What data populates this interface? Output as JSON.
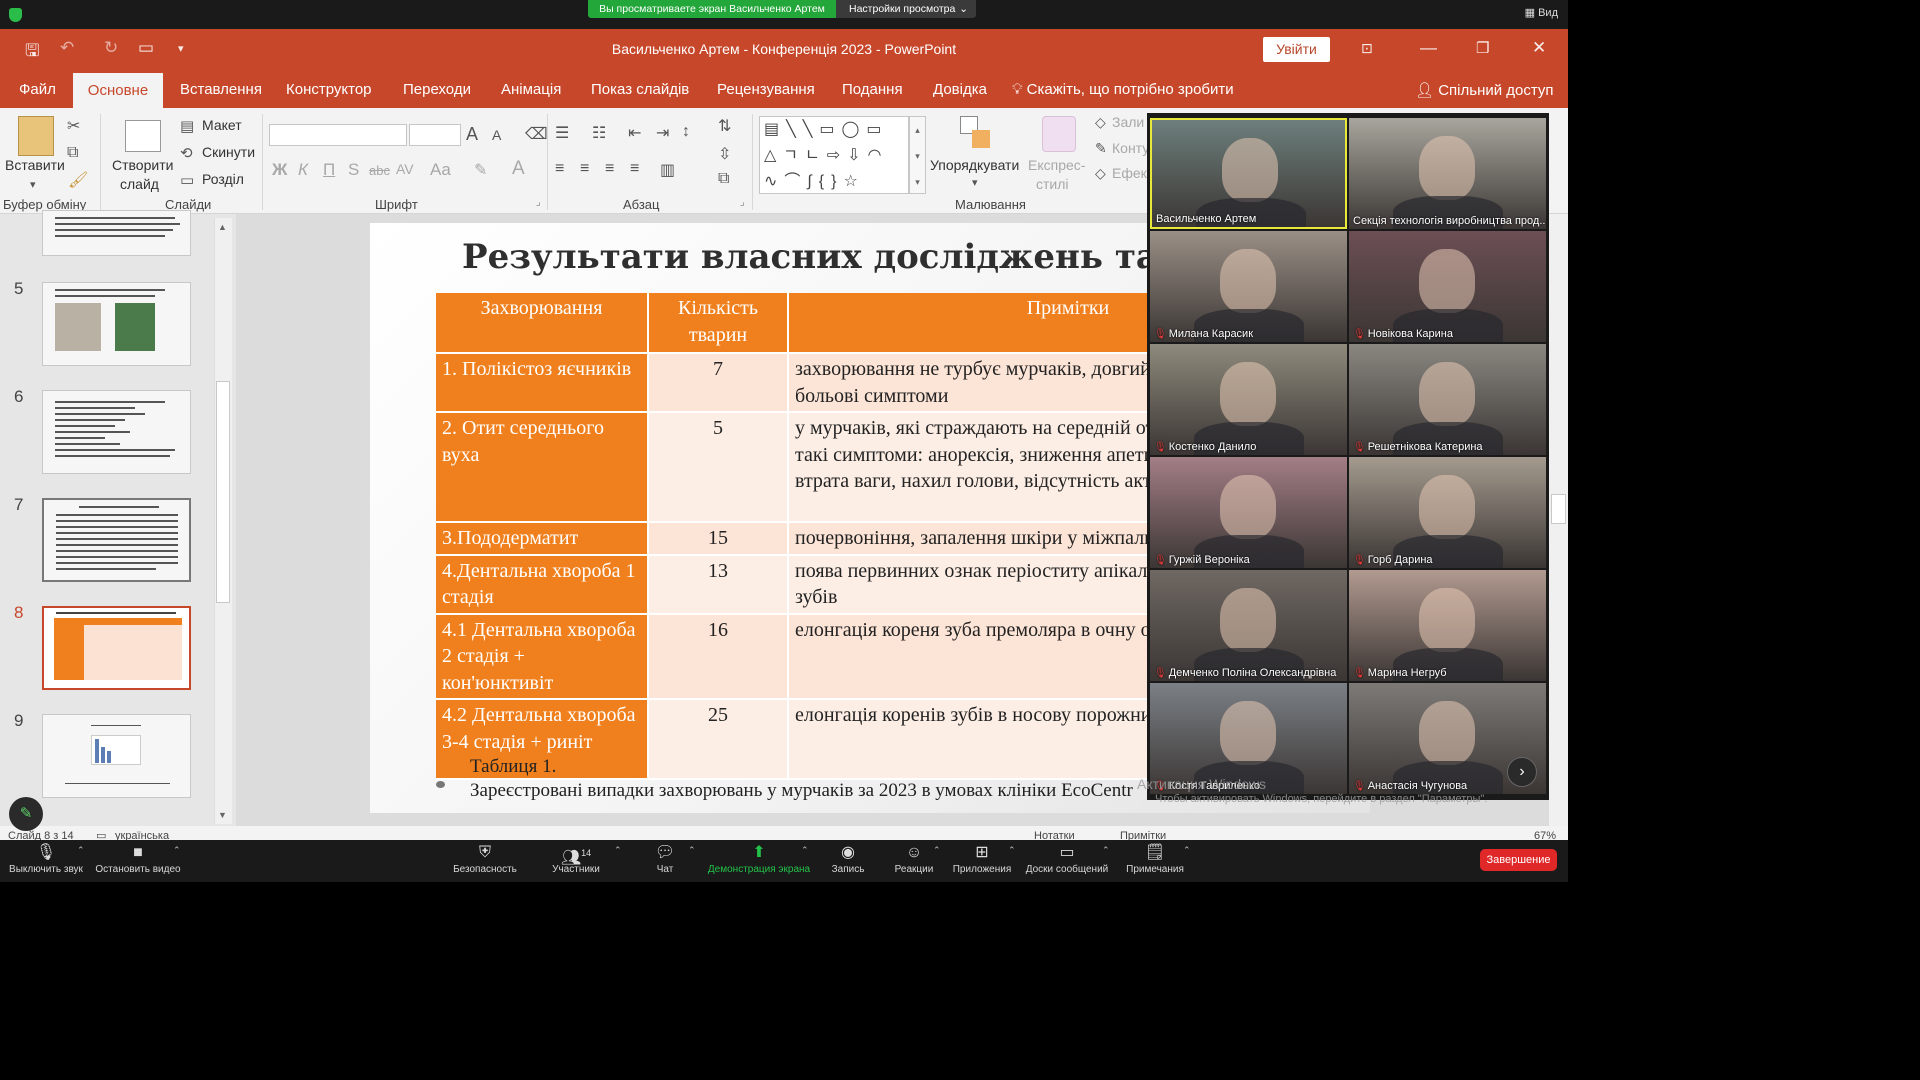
{
  "zoom_top": {
    "banner": "Вы просматриваете экран Васильченко Артем",
    "view_options": "Настройки просмотра",
    "view_label": "Вид"
  },
  "titlebar": {
    "title": "Васильченко Артем - Конференція 2023  -  PowerPoint",
    "signin": "Увійти"
  },
  "tabs": [
    "Файл",
    "Основне",
    "Вставлення",
    "Конструктор",
    "Переходи",
    "Анімація",
    "Показ слайдів",
    "Рецензування",
    "Подання",
    "Довідка"
  ],
  "tell_me": "Скажіть, що потрібно зробити",
  "share": "Спільний доступ",
  "ribbon": {
    "paste": "Вставити",
    "clipboard": "Буфер обміну",
    "new_slide_1": "Створити",
    "new_slide_2": "слайд",
    "layout": "Макет",
    "reset": "Скинути",
    "section": "Розділ",
    "slides": "Слайди",
    "font": "Шрифт",
    "bold": "Ж",
    "italic": "К",
    "underline": "П",
    "shadow": "S",
    "strike": "abc",
    "spacing": "AV",
    "case": "Aa",
    "paragraph": "Абзац",
    "arrange": "Упорядкувати",
    "quick_styles_1": "Експрес-",
    "quick_styles_2": "стилі",
    "fill": "Зали",
    "outline": "Конту",
    "effects": "Ефек",
    "drawing": "Малювання"
  },
  "thumbnails": [
    {
      "num": "5"
    },
    {
      "num": "6"
    },
    {
      "num": "7"
    },
    {
      "num": "8"
    },
    {
      "num": "9"
    }
  ],
  "slide": {
    "title": "Результати власних досліджень та їх аналіз",
    "headers": [
      "Захворювання",
      "Кількість тварин",
      "Примітки"
    ],
    "rows": [
      {
        "disease": "1. Полікістоз яєчників",
        "count": "7",
        "note": "захворювання не турбує мурчаків, довгий час не виявляючи больові симптоми"
      },
      {
        "disease": "2. Отит середнього вуха",
        "count": "5",
        "note": "у мурчаків, які страждають на середній отит, спостерігаються такі симптоми: анорексія, зниження апетиту, різка і поступова втрата ваги, нахил голови, відсутність активності."
      },
      {
        "disease": "3.Пододерматит",
        "count": "15",
        "note": "почервоніння, запалення шкіри у міжпальцевих ділянках"
      },
      {
        "disease": "4.Дентальна хвороба 1 стадія",
        "count": "13",
        "note": "поява первинних ознак періоститу апікальних коренів щічних зубів"
      },
      {
        "disease": "4.1 Дентальна хвороба 2 стадія + кон'юнктивіт",
        "count": "16",
        "note": "елонгація кореня зуба премоляра в очну орбіту"
      },
      {
        "disease": "4.2 Дентальна хвороба 3-4 стадія + риніт",
        "count": "25",
        "note": "елонгація коренів зубів в носову порожнину"
      }
    ],
    "caption_1": "Таблиця 1.",
    "caption_2": "Зареєстровані випадки захворювань у мурчаків за 2023 в умовах клініки EcoCentr"
  },
  "status": {
    "slide_of": "Слайд 8 з 14",
    "language": "українська",
    "notes": "Нотатки",
    "comments": "Примітки",
    "zoom": "67%"
  },
  "participants": [
    {
      "name": "Васильченко Артем",
      "muted": false,
      "active": true,
      "bg": "#6d7f7c"
    },
    {
      "name": "Секція технологія виробництва прод...",
      "muted": false,
      "active": false,
      "bg": "#a8a69d"
    },
    {
      "name": "Милана Карасик",
      "muted": true,
      "active": false,
      "bg": "#9a8f86"
    },
    {
      "name": "Новікова Карина",
      "muted": true,
      "active": false,
      "bg": "#6c4f54"
    },
    {
      "name": "Костенко Данило",
      "muted": true,
      "active": false,
      "bg": "#8e8a7c"
    },
    {
      "name": "Решетнікова Катерина",
      "muted": true,
      "active": false,
      "bg": "#8a8781"
    },
    {
      "name": "Гуржій Вероніка",
      "muted": true,
      "active": false,
      "bg": "#a37e86"
    },
    {
      "name": "Горб Дарина",
      "muted": true,
      "active": false,
      "bg": "#a49a8e"
    },
    {
      "name": "Демченко Поліна  Олександрівна",
      "muted": true,
      "active": false,
      "bg": "#6f6863"
    },
    {
      "name": "Марина Негруб",
      "muted": true,
      "active": false,
      "bg": "#b29a90"
    },
    {
      "name": "Костя Гавриленко",
      "muted": true,
      "active": false,
      "bg": "#7b8086"
    },
    {
      "name": "Анастасія Чугунова",
      "muted": true,
      "active": false,
      "bg": "#7d7a77"
    }
  ],
  "watermark_1": "Активация Windows",
  "watermark_2": "Чтобы активировать Windows, перейдите в раздел \"Параметры\".",
  "zoom_bottom": {
    "mute": "Выключить звук",
    "video": "Остановить видео",
    "security": "Безопасность",
    "participants": "Участники",
    "participants_count": "14",
    "chat": "Чат",
    "share": "Демонстрация экрана",
    "record": "Запись",
    "reactions": "Реакции",
    "apps": "Приложения",
    "whiteboards": "Доски сообщений",
    "notes": "Примечания",
    "end": "Завершение"
  }
}
